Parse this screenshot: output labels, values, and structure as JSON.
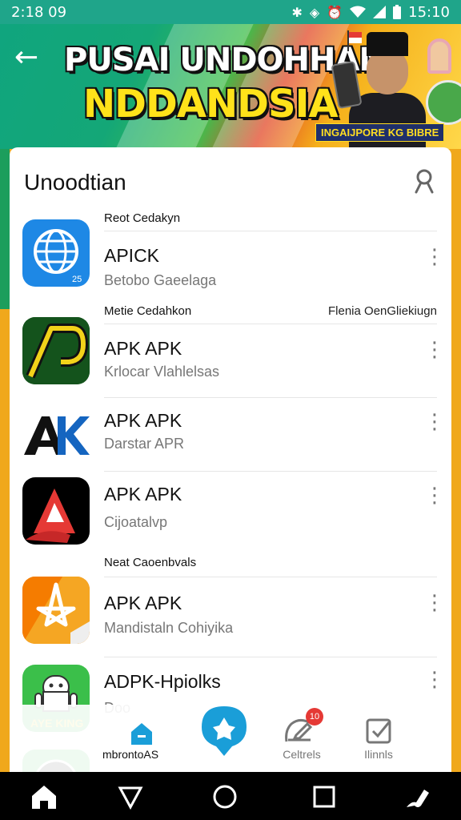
{
  "status_bar": {
    "time_left": "2:18 09",
    "time_right": "15:10"
  },
  "banner": {
    "title_line1": "PUSAI UNDOHHAN",
    "title_line2": "NDDANDSIA",
    "tag": "INGAIJPORE KG BIBRE"
  },
  "card": {
    "title": "Unoodtian"
  },
  "sections": [
    {
      "label": "Reot Cedakyn"
    },
    {
      "label": "Metie Cedahkon",
      "right": "Flenia OenGliekiugn"
    },
    {
      "label": "Neat Caoenbvals"
    }
  ],
  "apps": [
    {
      "name": "APICK",
      "subtitle": "Betobo Gaeelaga",
      "icon": "globe-icon"
    },
    {
      "name": "APK APK",
      "subtitle": "Krlocar Vlahlelsas",
      "icon": "apk-logo-icon"
    },
    {
      "name": "APK APK",
      "subtitle": "Darstar APR",
      "icon": "ak-logo-icon"
    },
    {
      "name": "APK APK",
      "subtitle": "Cijoatalvp",
      "icon": "red-a-logo-icon"
    },
    {
      "name": "APK APK",
      "subtitle": "Mandistaln Cohiyika",
      "icon": "star-logo-icon"
    },
    {
      "name": "ADPK-Hpiolks",
      "subtitle": "Doo",
      "icon": "android-logo-icon"
    },
    {
      "name": "mbrontoAS",
      "subtitle": "",
      "icon": "clock-logo-icon"
    }
  ],
  "bottom_nav": {
    "items": [
      {
        "label": "",
        "icon": "home-tab-icon"
      },
      {
        "label": "",
        "icon": "chat-fab-icon"
      },
      {
        "label": "Celtrels",
        "icon": "edit-icon",
        "badge": "10"
      },
      {
        "label": "Ilinnls",
        "icon": "checkbox-icon"
      }
    ]
  },
  "colors": {
    "status_bar": "#1fa58a",
    "accent": "#1a9ed8",
    "badge": "#e53935",
    "page_bg": "#f0a81c"
  }
}
